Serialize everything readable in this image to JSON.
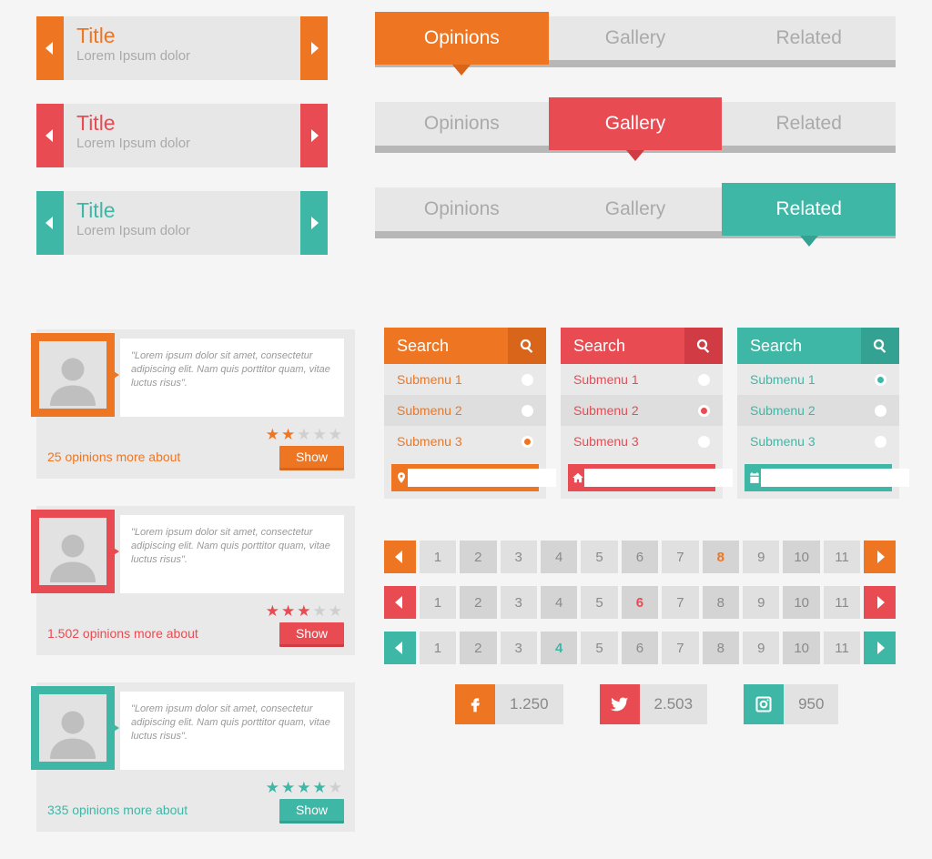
{
  "colors": {
    "orange": "#ee7623",
    "red": "#e94b52",
    "teal": "#3fb7a6"
  },
  "sliders": [
    {
      "theme": "orange",
      "title": "Title",
      "subtitle": "Lorem Ipsum dolor"
    },
    {
      "theme": "red",
      "title": "Title",
      "subtitle": "Lorem Ipsum dolor"
    },
    {
      "theme": "teal",
      "title": "Title",
      "subtitle": "Lorem Ipsum dolor"
    }
  ],
  "tabsets": [
    {
      "theme": "orange",
      "tabs": [
        "Opinions",
        "Gallery",
        "Related"
      ],
      "active": 0
    },
    {
      "theme": "red",
      "tabs": [
        "Opinions",
        "Gallery",
        "Related"
      ],
      "active": 1
    },
    {
      "theme": "teal",
      "tabs": [
        "Opinions",
        "Gallery",
        "Related"
      ],
      "active": 2
    }
  ],
  "opinion_cards": [
    {
      "theme": "orange",
      "quote": "\"Lorem ipsum dolor sit amet, consectetur adipiscing elit. Nam quis porttitor quam, vitae luctus risus\".",
      "rating": 2,
      "footer": "25 opinions more about",
      "button": "Show"
    },
    {
      "theme": "red",
      "quote": "\"Lorem ipsum dolor sit amet, consectetur adipiscing elit. Nam quis porttitor quam, vitae luctus risus\".",
      "rating": 3,
      "footer": "1.502 opinions more about",
      "button": "Show"
    },
    {
      "theme": "teal",
      "quote": "\"Lorem ipsum dolor sit amet, consectetur adipiscing elit. Nam quis porttitor quam, vitae luctus risus\".",
      "rating": 4,
      "footer": "335 opinions more about",
      "button": "Show"
    }
  ],
  "search_panels": [
    {
      "theme": "orange",
      "title": "Search",
      "items": [
        "Submenu 1",
        "Submenu 2",
        "Submenu 3"
      ],
      "selected": 2,
      "footer_icon": "pin"
    },
    {
      "theme": "red",
      "title": "Search",
      "items": [
        "Submenu 1",
        "Submenu 2",
        "Submenu 3"
      ],
      "selected": 1,
      "footer_icon": "home"
    },
    {
      "theme": "teal",
      "title": "Search",
      "items": [
        "Submenu 1",
        "Submenu 2",
        "Submenu 3"
      ],
      "selected": 0,
      "footer_icon": "calendar"
    }
  ],
  "paginations": [
    {
      "theme": "orange",
      "pages": [
        1,
        2,
        3,
        4,
        5,
        6,
        7,
        8,
        9,
        10,
        11
      ],
      "current": 8
    },
    {
      "theme": "red",
      "pages": [
        1,
        2,
        3,
        4,
        5,
        6,
        7,
        8,
        9,
        10,
        11
      ],
      "current": 6
    },
    {
      "theme": "teal",
      "pages": [
        1,
        2,
        3,
        4,
        5,
        6,
        7,
        8,
        9,
        10,
        11
      ],
      "current": 4
    }
  ],
  "social": [
    {
      "theme": "orange",
      "icon": "facebook",
      "count": "1.250"
    },
    {
      "theme": "red",
      "icon": "twitter",
      "count": "2.503"
    },
    {
      "theme": "teal",
      "icon": "instagram",
      "count": "950"
    }
  ]
}
